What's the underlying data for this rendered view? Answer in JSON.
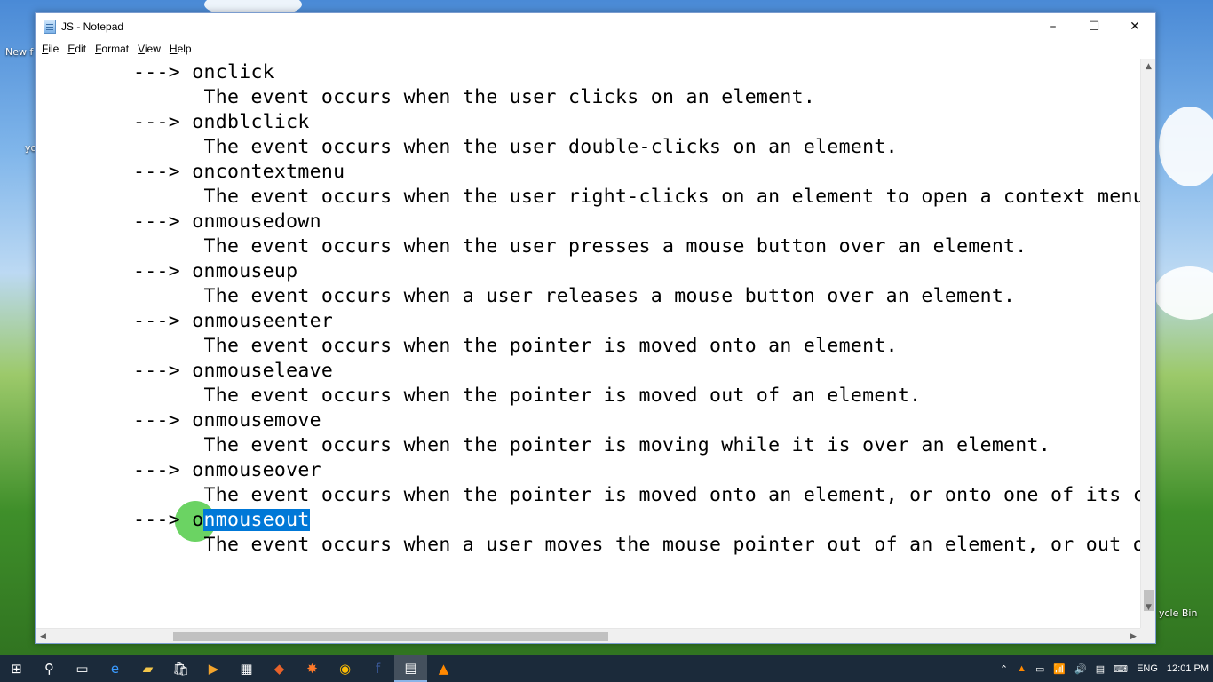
{
  "window": {
    "title": "JS - Notepad",
    "controls": {
      "minimize": "–",
      "maximize": "☐",
      "close": "✕"
    }
  },
  "menubar": [
    {
      "label": "File",
      "mnemonic": "F",
      "rest": "ile"
    },
    {
      "label": "Edit",
      "mnemonic": "E",
      "rest": "dit"
    },
    {
      "label": "Format",
      "mnemonic": "F",
      "rest": "ormat"
    },
    {
      "label": "View",
      "mnemonic": "V",
      "rest": "iew"
    },
    {
      "label": "Help",
      "mnemonic": "H",
      "rest": "elp"
    }
  ],
  "editor": {
    "lines": [
      "---> onclick",
      "      The event occurs when the user clicks on an element.",
      "---> ondblclick",
      "      The event occurs when the user double-clicks on an element.",
      "---> oncontextmenu",
      "      The event occurs when the user right-clicks on an element to open a context menu.",
      "---> onmousedown",
      "      The event occurs when the user presses a mouse button over an element.",
      "---> onmouseup",
      "      The event occurs when a user releases a mouse button over an element.",
      "---> onmouseenter",
      "      The event occurs when the pointer is moved onto an element.",
      "---> onmouseleave",
      "      The event occurs when the pointer is moved out of an element.",
      "---> onmousemove",
      "      The event occurs when the pointer is moving while it is over an element.",
      "---> onmouseover",
      "      The event occurs when the pointer is moved onto an element, or onto one of its ch",
      "---> on",
      "      The event occurs when a user moves the mouse pointer out of an element, or out of"
    ],
    "selected_line_prefix": "---> o",
    "selected_text": "nmouseout"
  },
  "desktop": {
    "icons": [
      "New f",
      "yo",
      "ycle Bin"
    ]
  },
  "taskbar": {
    "start": "⊞",
    "icons": [
      "search-icon",
      "task-view-icon",
      "edge-icon",
      "file-explorer-icon",
      "store-icon",
      "media-icon",
      "film-icon",
      "fox-icon",
      "paint-icon",
      "chrome-icon",
      "facebook-icon",
      "notepad-icon",
      "vlc-icon"
    ],
    "tray": {
      "lang": "ENG",
      "time": "12:01 PM"
    }
  }
}
